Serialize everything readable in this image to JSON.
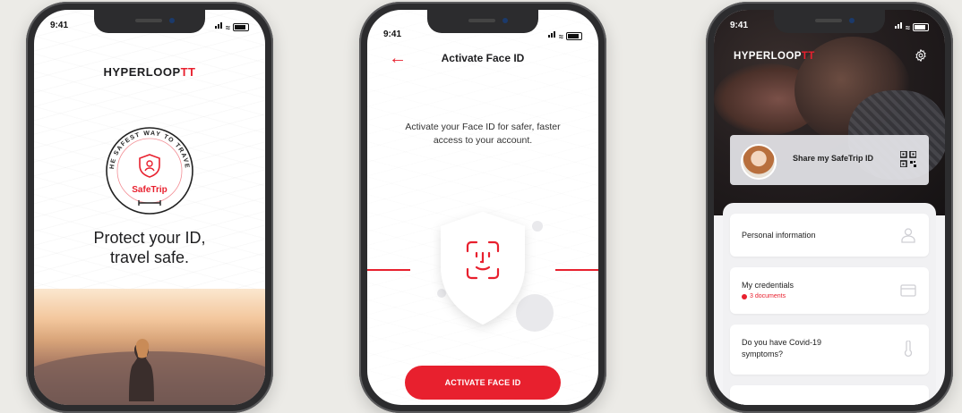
{
  "phone1": {
    "time": "9:41",
    "brand_main": "HYPERLOOP",
    "brand_accent": "TT",
    "badge_ring_text": "THE SAFEST WAY TO TRAVEL",
    "badge_name": "SafeTrip",
    "headline_line1": "Protect your ID,",
    "headline_line2": "travel safe."
  },
  "phone2": {
    "time": "9:41",
    "back_icon": "arrow-left-icon",
    "title": "Activate Face ID",
    "description": "Activate your Face ID for safer, faster access to your account.",
    "cta_label": "ACTIVATE FACE ID"
  },
  "phone3": {
    "time": "9:41",
    "brand_main": "HYPERLOOP",
    "brand_accent": "TT",
    "share_label": "Share my SafeTrip ID",
    "items": [
      {
        "title": "Personal information",
        "subtitle": "",
        "icon": "person-icon"
      },
      {
        "title": "My credentials",
        "subtitle": "3 documents",
        "icon": "card-icon"
      },
      {
        "title": "Do you have Covid-19 symptoms?",
        "subtitle": "",
        "icon": "thermometer-icon"
      }
    ]
  },
  "colors": {
    "accent": "#e8202e",
    "background": "#ecebe7",
    "phone_frame": "#2c2c2e"
  }
}
